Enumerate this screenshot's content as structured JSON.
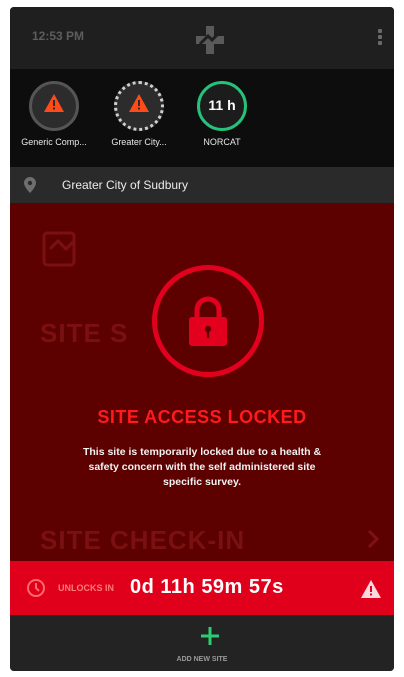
{
  "status_bar": {
    "time": "12:53 PM"
  },
  "sites": [
    {
      "label": "Generic Comp...",
      "status": "warning"
    },
    {
      "label": "Greater City...",
      "status": "warning-selected"
    },
    {
      "label": "NORCAT",
      "timer": "11 h"
    }
  ],
  "location": {
    "name": "Greater City of Sudbury"
  },
  "background_sections": {
    "section_1": "SITE S",
    "section_2": "SITE CHECK-IN"
  },
  "lock_notice": {
    "title": "SITE ACCESS LOCKED",
    "body": "This site is temporarily locked due to a health & safety concern with the self administered site specific survey."
  },
  "countdown": {
    "label": "UNLOCKS IN",
    "value": "0d 11h 59m 57s"
  },
  "bottom_action": {
    "label": "ADD NEW SITE"
  },
  "colors": {
    "accent_red": "#e0001b",
    "overlay_red": "#5c0000",
    "timer_green": "#26c17a",
    "add_green": "#2ecc71"
  },
  "icons": [
    "logo-icon",
    "menu-icon",
    "warning-icon",
    "pin-icon",
    "lock-icon",
    "clock-icon",
    "alert-icon",
    "plus-icon"
  ]
}
